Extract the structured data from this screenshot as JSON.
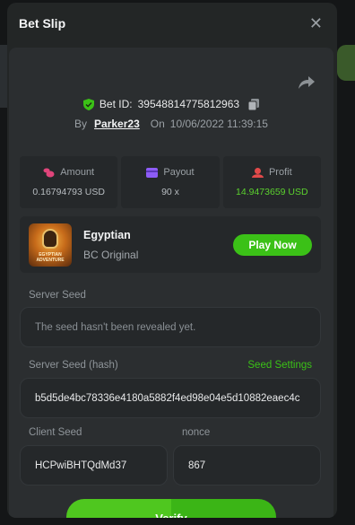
{
  "modal": {
    "title": "Bet Slip",
    "close_icon": "close-icon"
  },
  "bet": {
    "id_label": "Bet ID:",
    "id_value": "39548814775812963",
    "by_label": "By",
    "username": "Parker23",
    "on_label": "On",
    "date": "10/06/2022 11:39:15"
  },
  "stats": {
    "amount": {
      "label": "Amount",
      "value": "0.16794793 USD",
      "icon": "coins-icon",
      "color": "#e0457b"
    },
    "payout": {
      "label": "Payout",
      "value": "90 x",
      "icon": "card-icon",
      "color": "#8d5cf6"
    },
    "profit": {
      "label": "Profit",
      "value": "14.9473659 USD",
      "icon": "profit-icon",
      "color": "#e24a4a"
    }
  },
  "game": {
    "name": "Egyptian",
    "provider": "BC Original",
    "thumb_text": "EGYPTIAN ADVENTURE",
    "play_label": "Play Now"
  },
  "seeds": {
    "server_seed_label": "Server Seed",
    "server_seed_value": "The seed hasn't been revealed yet.",
    "server_hash_label": "Server Seed (hash)",
    "seed_settings_label": "Seed Settings",
    "server_hash_value": "b5d5de4bc78336e4180a5882f4ed98e04e5d10882eaec4c",
    "client_seed_label": "Client Seed",
    "client_seed_value": "HCPwiBHTQdMd37",
    "nonce_label": "nonce",
    "nonce_value": "867"
  },
  "actions": {
    "verify_label": "Verify"
  },
  "colors": {
    "accent_green": "#3bc117",
    "panel": "#2b2e30",
    "modal": "#232626"
  }
}
